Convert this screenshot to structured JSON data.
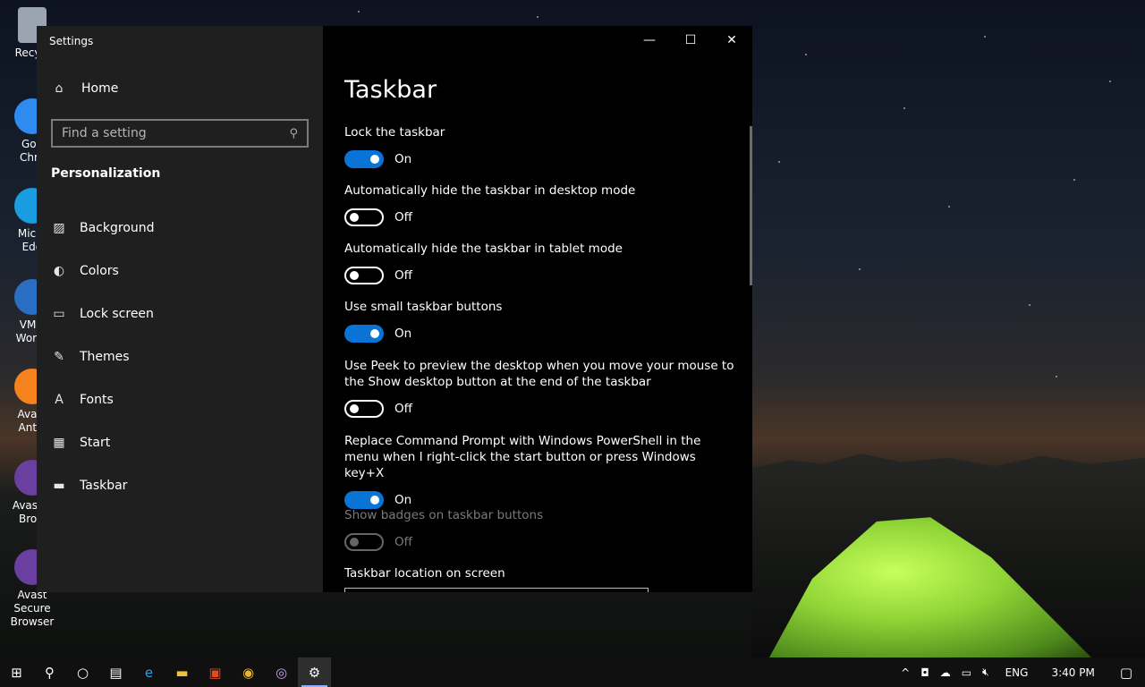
{
  "desktop": {
    "icons": [
      {
        "label": "Recycl",
        "name": "recycle-bin-icon"
      },
      {
        "label": "Goo\nChro",
        "name": "chrome-icon"
      },
      {
        "label": "Micro\nEdg",
        "name": "edge-icon"
      },
      {
        "label": "VMw\nWorks",
        "name": "vmware-icon"
      },
      {
        "label": "Avast\nAntiv",
        "name": "avast-antivirus-icon"
      },
      {
        "label": "Avast S\nBrow",
        "name": "avast-browser-icon"
      },
      {
        "label": "Avast Secure\nBrowser",
        "name": "avast-secure-browser-icon"
      }
    ]
  },
  "window": {
    "title": "Settings",
    "caption": {
      "minimize": "—",
      "maximize": "☐",
      "close": "✕"
    }
  },
  "sidebar": {
    "home": "Home",
    "search_placeholder": "Find a setting",
    "section": "Personalization",
    "items": [
      {
        "label": "Background",
        "icon": "▨"
      },
      {
        "label": "Colors",
        "icon": "◐"
      },
      {
        "label": "Lock screen",
        "icon": "▭"
      },
      {
        "label": "Themes",
        "icon": "✎"
      },
      {
        "label": "Fonts",
        "icon": "A"
      },
      {
        "label": "Start",
        "icon": "▦"
      },
      {
        "label": "Taskbar",
        "icon": "▬"
      }
    ]
  },
  "main": {
    "title": "Taskbar",
    "settings": [
      {
        "label": "Lock the taskbar",
        "state": "On",
        "on": true,
        "disabled": false
      },
      {
        "label": "Automatically hide the taskbar in desktop mode",
        "state": "Off",
        "on": false,
        "disabled": false
      },
      {
        "label": "Automatically hide the taskbar in tablet mode",
        "state": "Off",
        "on": false,
        "disabled": false
      },
      {
        "label": "Use small taskbar buttons",
        "state": "On",
        "on": true,
        "disabled": false
      },
      {
        "label": "Use Peek to preview the desktop when you move your mouse to the Show desktop button at the end of the taskbar",
        "state": "Off",
        "on": false,
        "disabled": false
      },
      {
        "label": "Replace Command Prompt with Windows PowerShell in the menu when I right-click the start button or press Windows key+X",
        "state": "On",
        "on": true,
        "disabled": false
      },
      {
        "label": "Show badges on taskbar buttons",
        "state": "Off",
        "on": false,
        "disabled": true
      }
    ],
    "location_label": "Taskbar location on screen"
  },
  "taskbar": {
    "buttons": [
      "⊞",
      "⚲",
      "○",
      "▤",
      "e",
      "▬",
      "▣",
      "◉",
      "◎",
      "⚙"
    ],
    "tray": {
      "lang": "ENG",
      "time": "3:40 PM",
      "chevron": "^",
      "notification": "▢"
    }
  }
}
